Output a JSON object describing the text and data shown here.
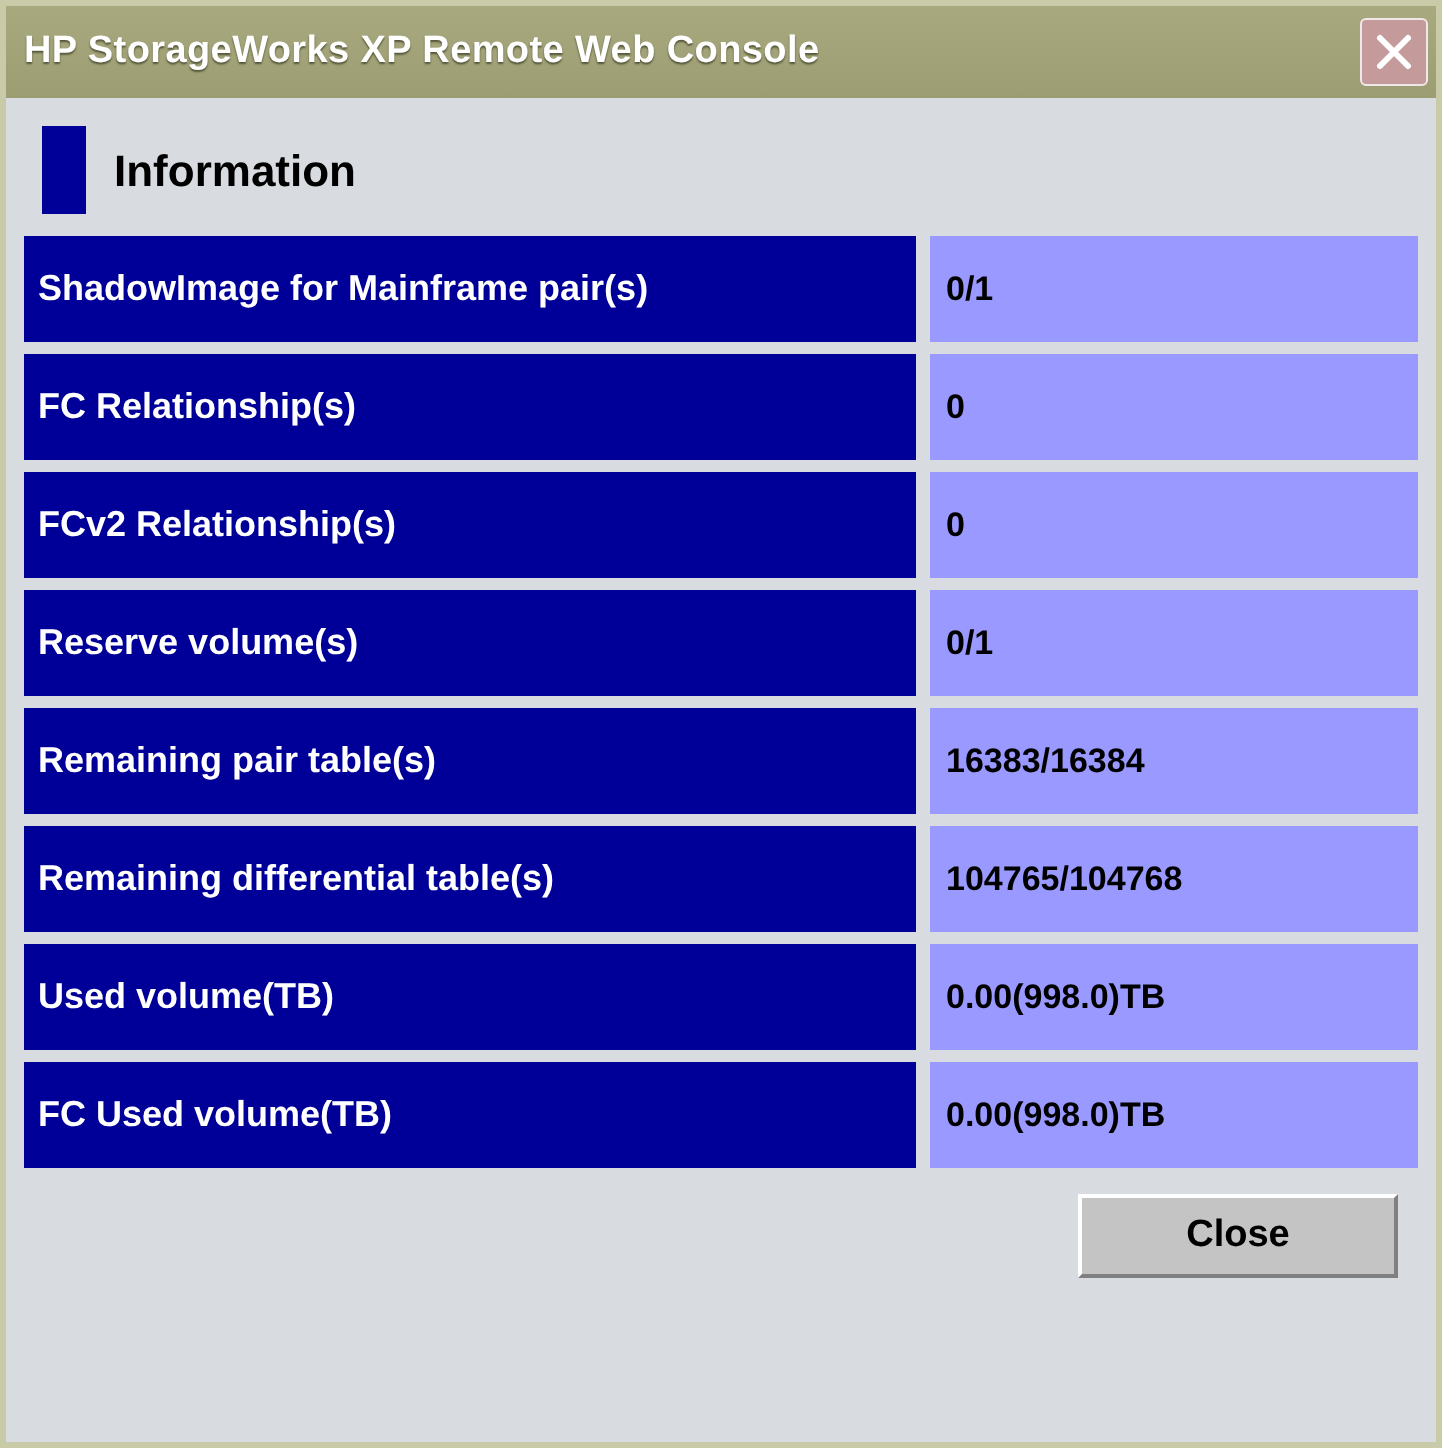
{
  "window": {
    "title": "HP StorageWorks XP Remote Web Console"
  },
  "section": {
    "title": "Information"
  },
  "rows": [
    {
      "label": "ShadowImage for Mainframe pair(s)",
      "value": "0/1"
    },
    {
      "label": "FC Relationship(s)",
      "value": "0"
    },
    {
      "label": "FCv2 Relationship(s)",
      "value": "0"
    },
    {
      "label": "Reserve volume(s)",
      "value": "0/1"
    },
    {
      "label": "Remaining pair table(s)",
      "value": "16383/16384"
    },
    {
      "label": "Remaining differential table(s)",
      "value": "104765/104768"
    },
    {
      "label": "Used volume(TB)",
      "value": "0.00(998.0)TB"
    },
    {
      "label": "FC Used volume(TB)",
      "value": "0.00(998.0)TB"
    }
  ],
  "buttons": [
    "Close"
  ]
}
